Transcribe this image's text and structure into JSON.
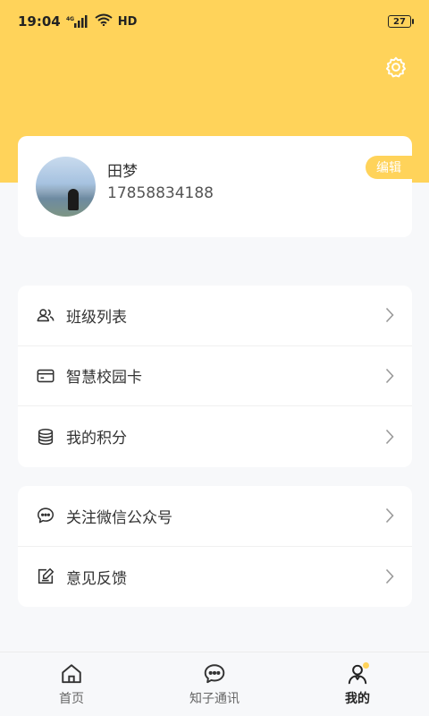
{
  "status_bar": {
    "time": "19:04",
    "network": "4G",
    "hd": "HD",
    "battery": "27"
  },
  "header": {
    "settings_icon": "gear-icon",
    "bg_color": "#ffd35a"
  },
  "profile": {
    "name": "田梦",
    "phone": "17858834188",
    "edit_label": "编辑"
  },
  "menu_group_1": [
    {
      "label": "班级列表",
      "icon": "users-icon"
    },
    {
      "label": "智慧校园卡",
      "icon": "card-icon"
    },
    {
      "label": "我的积分",
      "icon": "coins-icon"
    }
  ],
  "menu_group_2": [
    {
      "label": "关注微信公众号",
      "icon": "chat-bubble-icon"
    },
    {
      "label": "意见反馈",
      "icon": "feedback-icon"
    }
  ],
  "tabbar": {
    "tabs": [
      {
        "label": "首页",
        "icon": "home-icon",
        "active": false
      },
      {
        "label": "知子通讯",
        "icon": "message-icon",
        "active": false
      },
      {
        "label": "我的",
        "icon": "profile-icon",
        "active": true
      }
    ]
  }
}
